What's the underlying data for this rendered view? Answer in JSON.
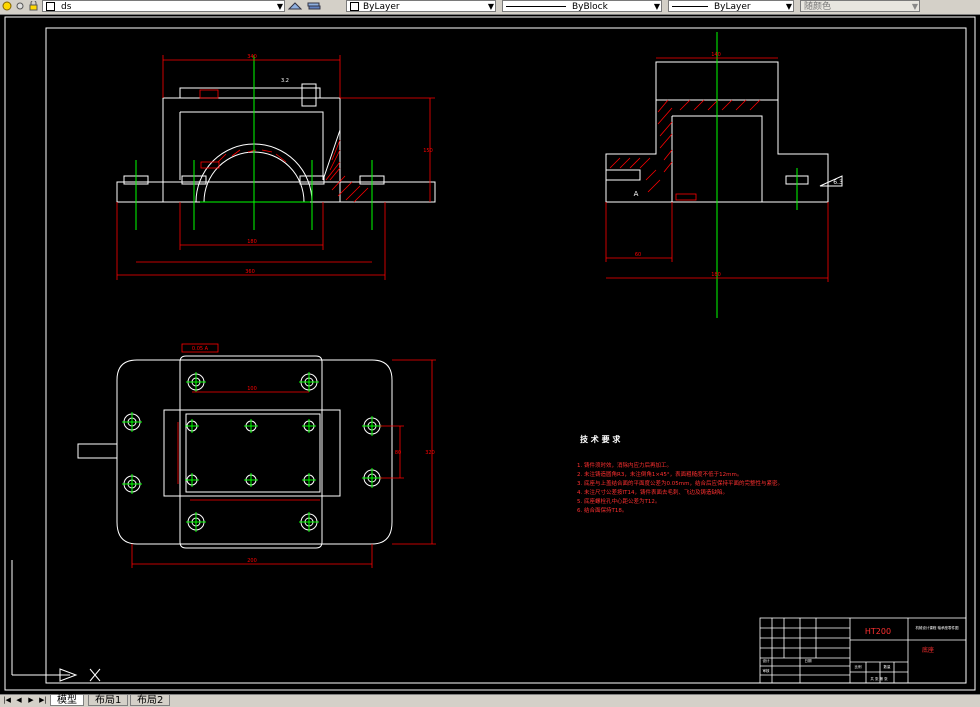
{
  "toolbar": {
    "layer_name": "ds",
    "color_control": "ByLayer",
    "linetype_control": "ByBlock",
    "lineweight_control": "ByLayer",
    "plotstyle_control": "随颜色"
  },
  "tabs": [
    {
      "label": "模型"
    },
    {
      "label": "布局1"
    },
    {
      "label": "布局2"
    }
  ],
  "drawing": {
    "tech_req_title": "技 术 要 求",
    "tech_req_items": [
      "1. 铸件须时效，消除内应力后再加工。",
      "2. 未注铸造圆角R3，未注倒角1×45°，表面粗糙度不低于12mm。",
      "3. 底座与上盖结合面的平面度公差为0.05mm，结合后应保持平面的完整性与紧密。",
      "4. 未注尺寸公差按IT14，铸件表面去毛刺、飞边及铸造缺陷。",
      "5. 底座螺栓孔中心距公差为T12。",
      "6. 结合面保持T18。"
    ],
    "material": "HT200",
    "part_name": "底座",
    "title_small": "机械设计课程 轴承座零件图",
    "drawn_by_label": "设计",
    "check_label": "审核",
    "date_label": "日期",
    "scale_label": "比例",
    "qty_label": "数量",
    "sheet_label": "共 张 第 张",
    "dims": {
      "front_width": "340",
      "front_inner": "180",
      "front_height": "150",
      "front_overall": "360",
      "side_width": "140",
      "side_total": "180",
      "side_base": "60",
      "top_hole": "100",
      "top_span": "200",
      "top_width": "320",
      "top_right": "80"
    },
    "annotations": {
      "roughness_a": "3.2",
      "roughness_b": "6.3",
      "angle_a": "A",
      "tol_frame_a": "0.05 A",
      "tol_frame_b": "∥ 0.05 A"
    }
  },
  "colors": {
    "background": "#000000",
    "outline": "#ffffff",
    "centerline": "#00ff00",
    "dimension": "#ff0000",
    "hatch": "#ff0000",
    "text": "#ffffff"
  }
}
